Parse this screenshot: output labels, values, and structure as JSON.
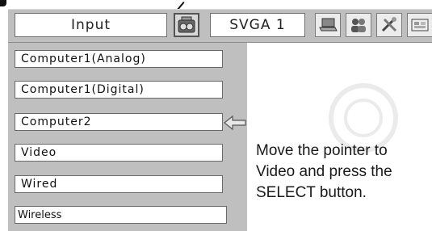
{
  "menubar": {
    "input_label": "Input",
    "signal_label": "SVGA 1",
    "icons": [
      "input-select-icon",
      "laptop-icon",
      "people-icon",
      "tools-icon",
      "screen-icon"
    ]
  },
  "input_list": {
    "items": [
      {
        "label": "Computer1(Analog)"
      },
      {
        "label": "Computer1(Digital)"
      },
      {
        "label": "Computer2"
      },
      {
        "label": "Video"
      },
      {
        "label": "Wired"
      },
      {
        "label": "Wireless"
      }
    ],
    "pointer_icon": "left-arrow-icon"
  },
  "instruction_text": "Move the pointer to Video and press the SELECT button.",
  "colors": {
    "panel": "#bfbfbf",
    "box": "#ffffff",
    "text": "#111111"
  }
}
